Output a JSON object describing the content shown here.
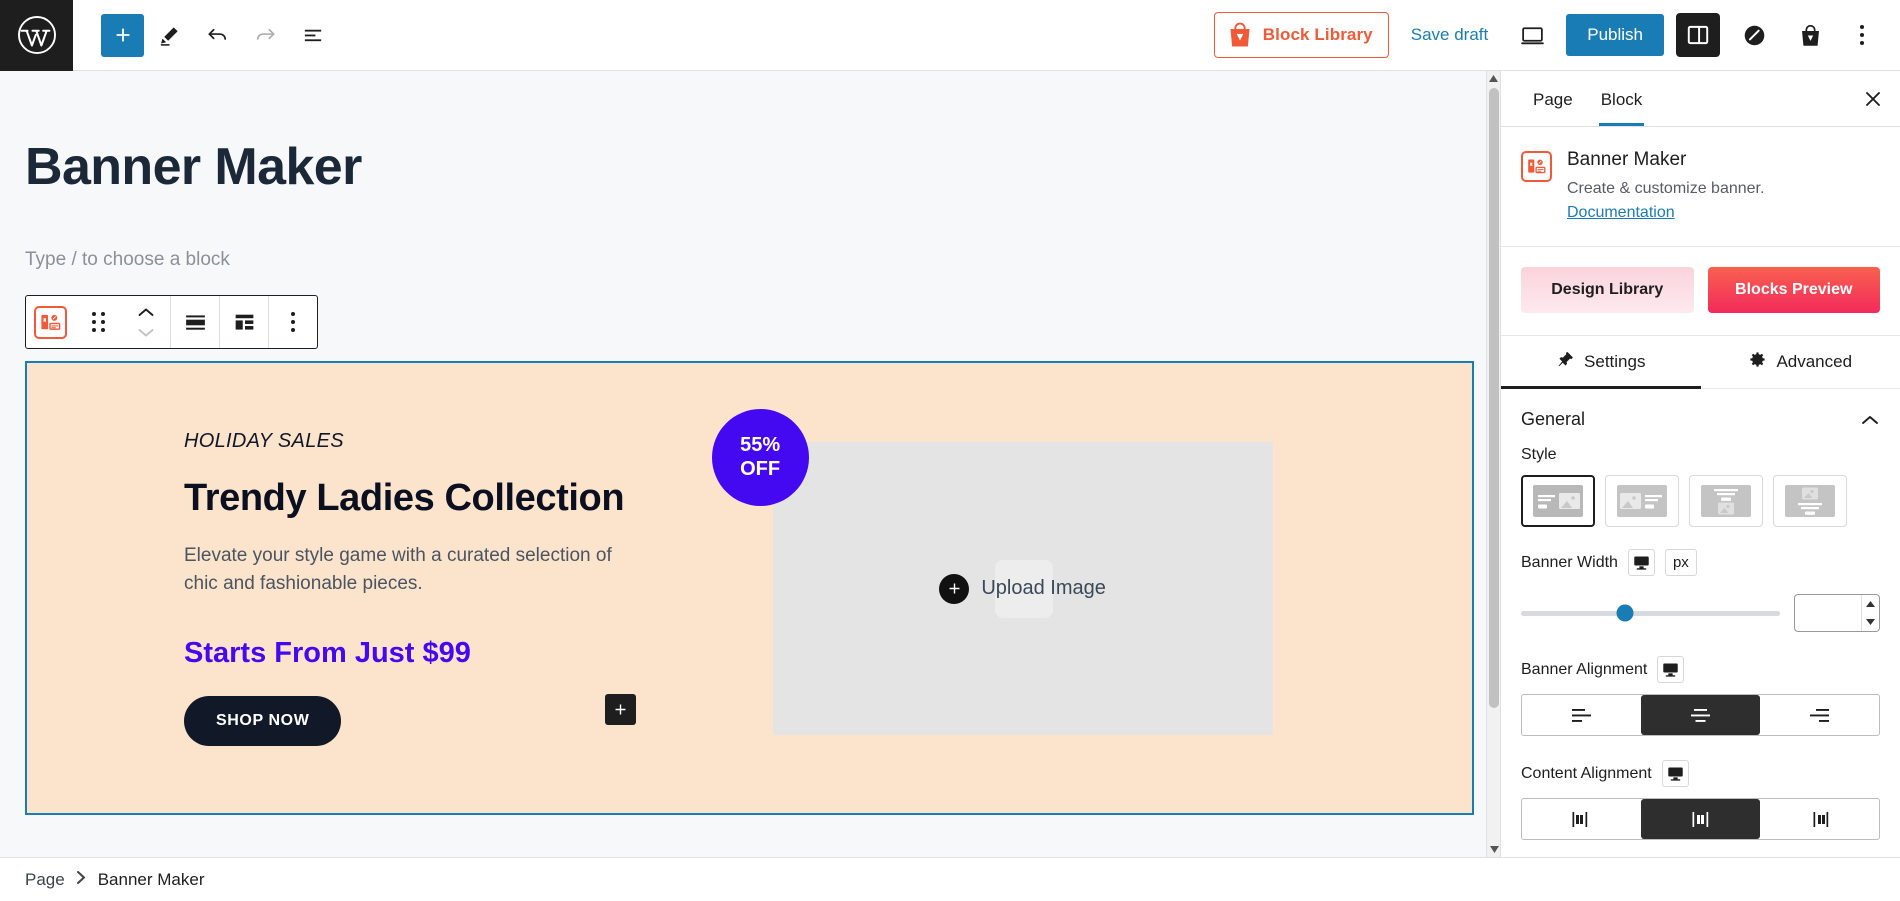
{
  "topbar": {
    "logo_icon": "wordpress-logo-icon",
    "add_block_label": "+",
    "tools": [
      {
        "name": "toggle-block-inserter",
        "icon": "plus-icon"
      },
      {
        "name": "edit-tool",
        "icon": "pencil-icon"
      },
      {
        "name": "undo",
        "icon": "undo-arrow-icon"
      },
      {
        "name": "redo",
        "icon": "redo-arrow-icon"
      },
      {
        "name": "document-overview",
        "icon": "list-view-icon"
      }
    ],
    "block_library_label": "Block Library",
    "save_draft_label": "Save draft",
    "publish_label": "Publish",
    "preview_icon": "desktop-preview-icon",
    "settings_icon": "sidebar-panel-icon",
    "plugin_icon": "slash-circle-icon",
    "shop_icon": "shopping-bag-icon",
    "more_icon": "three-dots-vertical-icon"
  },
  "canvas": {
    "page_title": "Banner Maker",
    "paragraph_placeholder": "Type / to choose a block",
    "block_toolbar": {
      "block_icon": "banner-maker-block-icon",
      "drag_icon": "drag-handle-icon",
      "move_up_icon": "chevron-up-icon",
      "move_down_icon": "chevron-down-icon",
      "align_icon": "align-full-width-icon",
      "layout_icon": "layout-grid-icon",
      "options_icon": "three-dots-vertical-icon"
    },
    "banner": {
      "kicker": "HOLIDAY SALES",
      "title": "Trendy Ladies Collection",
      "description": "Elevate your style game with a curated selection of chic and fashionable pieces.",
      "price": "Starts From Just $99",
      "cta_label": "SHOP NOW",
      "badge_line1": "55%",
      "badge_line2": "OFF",
      "upload_label": "Upload Image",
      "bg_color": "#fce3cb",
      "badge_color": "#4409f0",
      "price_color": "#4409f0",
      "cta_bg_color": "#111827",
      "selection_border_color": "#1a7cb5",
      "add_block_icon": "plus-icon"
    }
  },
  "sidebar": {
    "tabs": [
      {
        "label": "Page",
        "active": false
      },
      {
        "label": "Block",
        "active": true
      }
    ],
    "close_icon": "close-x-icon",
    "block": {
      "icon": "banner-maker-block-icon",
      "title": "Banner Maker",
      "description": "Create & customize banner.",
      "documentation_label": "Documentation"
    },
    "cta": {
      "design_library_label": "Design Library",
      "blocks_preview_label": "Blocks Preview"
    },
    "subtabs": [
      {
        "label": "Settings",
        "icon": "pin-icon",
        "active": true
      },
      {
        "label": "Advanced",
        "icon": "gear-icon",
        "active": false
      }
    ],
    "general": {
      "section_title": "General",
      "collapse_icon": "chevron-up-icon",
      "style": {
        "label": "Style",
        "options": [
          {
            "name": "style-text-left-image-right",
            "selected": true
          },
          {
            "name": "style-image-left-text-right",
            "selected": false
          },
          {
            "name": "style-text-top-image-bottom",
            "selected": false
          },
          {
            "name": "style-image-top-text-bottom",
            "selected": false
          }
        ]
      },
      "banner_width": {
        "label": "Banner Width",
        "device_icon": "desktop-icon",
        "unit": "px",
        "value": "",
        "slider_percent": 40
      },
      "banner_alignment": {
        "label": "Banner Alignment",
        "device_icon": "desktop-icon",
        "options": [
          {
            "name": "align-left",
            "selected": false
          },
          {
            "name": "align-center",
            "selected": true
          },
          {
            "name": "align-right",
            "selected": false
          }
        ]
      },
      "content_alignment": {
        "label": "Content Alignment",
        "device_icon": "desktop-icon",
        "options": [
          {
            "name": "content-align-left",
            "selected": false
          },
          {
            "name": "content-align-center",
            "selected": true
          },
          {
            "name": "content-align-right",
            "selected": false
          }
        ]
      }
    }
  },
  "footer": {
    "breadcrumbs": [
      "Page",
      "Banner Maker"
    ],
    "separator_icon": "chevron-right-icon"
  }
}
